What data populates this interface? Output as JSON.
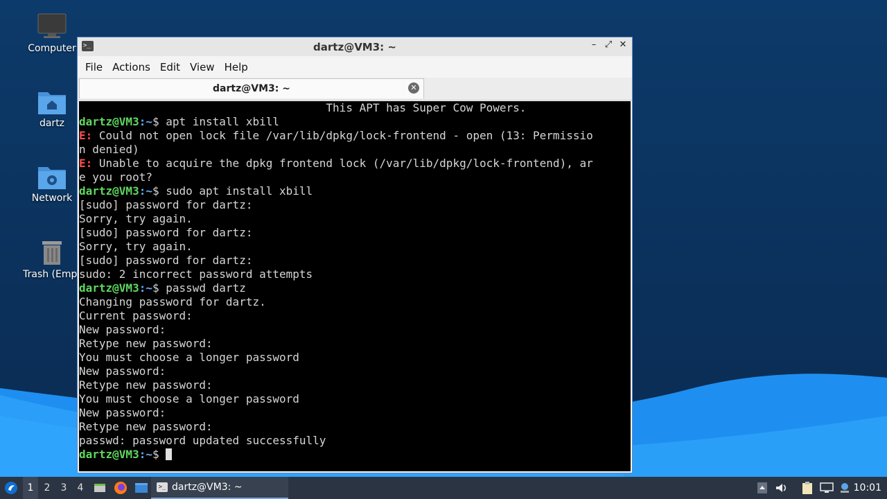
{
  "desktop": {
    "icons": [
      {
        "label": "Computer"
      },
      {
        "label": "dartz"
      },
      {
        "label": "Network"
      },
      {
        "label": "Trash (Empt"
      }
    ]
  },
  "window": {
    "title": "dartz@VM3: ~",
    "controls": {
      "minimize": "–",
      "maximize": "⤢",
      "close": "✕"
    },
    "menu": [
      "File",
      "Actions",
      "Edit",
      "View",
      "Help"
    ],
    "tab": {
      "label": "dartz@VM3: ~",
      "close": "✕"
    }
  },
  "terminal": {
    "user": "dartz@VM3",
    "path": ":~",
    "lines": [
      {
        "kind": "text",
        "text": "                                     This APT has Super Cow Powers."
      },
      {
        "kind": "prompt",
        "cmd": "$ apt install xbill"
      },
      {
        "kind": "error",
        "prefix": "E:",
        "text": " Could not open lock file /var/lib/dpkg/lock-frontend - open (13: Permissio"
      },
      {
        "kind": "text",
        "text": "n denied)"
      },
      {
        "kind": "error",
        "prefix": "E:",
        "text": " Unable to acquire the dpkg frontend lock (/var/lib/dpkg/lock-frontend), ar"
      },
      {
        "kind": "text",
        "text": "e you root?"
      },
      {
        "kind": "prompt",
        "cmd": "$ sudo apt install xbill"
      },
      {
        "kind": "text",
        "text": "[sudo] password for dartz:"
      },
      {
        "kind": "text",
        "text": "Sorry, try again."
      },
      {
        "kind": "text",
        "text": "[sudo] password for dartz:"
      },
      {
        "kind": "text",
        "text": "Sorry, try again."
      },
      {
        "kind": "text",
        "text": "[sudo] password for dartz:"
      },
      {
        "kind": "text",
        "text": "sudo: 2 incorrect password attempts"
      },
      {
        "kind": "prompt",
        "cmd": "$ passwd dartz"
      },
      {
        "kind": "text",
        "text": "Changing password for dartz."
      },
      {
        "kind": "text",
        "text": "Current password:"
      },
      {
        "kind": "text",
        "text": "New password:"
      },
      {
        "kind": "text",
        "text": "Retype new password:"
      },
      {
        "kind": "text",
        "text": "You must choose a longer password"
      },
      {
        "kind": "text",
        "text": "New password:"
      },
      {
        "kind": "text",
        "text": "Retype new password:"
      },
      {
        "kind": "text",
        "text": "You must choose a longer password"
      },
      {
        "kind": "text",
        "text": "New password:"
      },
      {
        "kind": "text",
        "text": "Retype new password:"
      },
      {
        "kind": "text",
        "text": "passwd: password updated successfully"
      },
      {
        "kind": "prompt-cursor",
        "cmd": "$ "
      }
    ]
  },
  "taskbar": {
    "workspaces": [
      "1",
      "2",
      "3",
      "4"
    ],
    "active_workspace": "1",
    "task_label": "dartz@VM3: ~",
    "clock": "10:01"
  },
  "colors": {
    "prompt_user": "#5fd75f",
    "prompt_path": "#5fafff",
    "error": "#ff4d4d",
    "terminal_bg": "#000000"
  }
}
